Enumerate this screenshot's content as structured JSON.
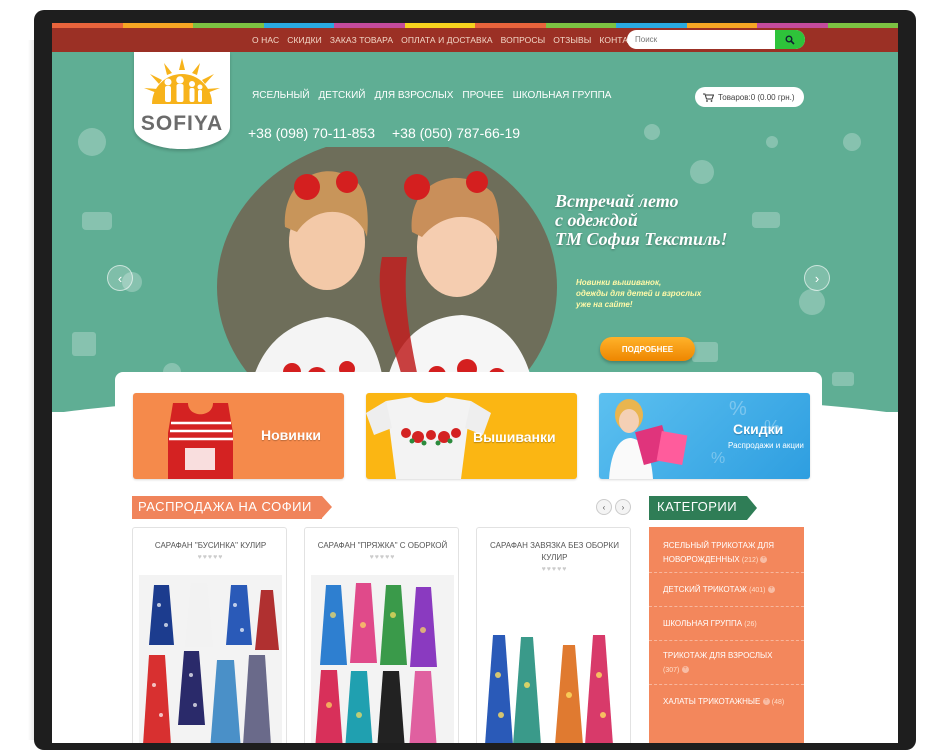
{
  "stripe_colors": [
    "#e8643c",
    "#f6a623",
    "#7cc142",
    "#2aa9e0",
    "#c44b9c",
    "#f6d21e",
    "#e8643c",
    "#7cc142",
    "#2aa9e0",
    "#f6a623",
    "#c44b9c",
    "#7cc142"
  ],
  "topnav": {
    "items": [
      "О НАС",
      "СКИДКИ",
      "ЗАКАЗ ТОВАРА",
      "ОПЛАТА И ДОСТАВКА",
      "ВОПРОСЫ",
      "ОТЗЫВЫ",
      "КОНТАКТЫ"
    ]
  },
  "search": {
    "placeholder": "Поиск",
    "icon": "search-icon"
  },
  "logo": {
    "text": "SOFIYA"
  },
  "mainnav": {
    "items": [
      "ЯСЕЛЬНЫЙ",
      "ДЕТСКИЙ",
      "ДЛЯ ВЗРОСЛЫХ",
      "ПРОЧЕЕ",
      "ШКОЛЬНАЯ ГРУППА"
    ]
  },
  "cart": {
    "label": "Товаров:0 (0.00 грн.)",
    "icon": "cart-icon"
  },
  "phones": [
    "+38 (098) 70-11-853",
    "+38 (050) 787-66-19"
  ],
  "hero": {
    "slogan": [
      "Встречай лето",
      "с одеждой",
      "ТМ София Текстиль!"
    ],
    "sub": [
      "Новинки вышиванок,",
      "одежды для детей и взрослых",
      "уже на сайте!"
    ],
    "button": "ПОДРОБНЕЕ",
    "prev": "‹",
    "next": "›"
  },
  "banners": [
    {
      "label": "Новинки",
      "color": "#f58a4b"
    },
    {
      "label": "Вышиванки",
      "color": "#fbb613"
    },
    {
      "label": "Скидки",
      "sub": "Распродажи и акции",
      "color": "#2e9ee0"
    }
  ],
  "sale": {
    "title": "РАСПРОДАЖА НА СОФИИ",
    "prev": "‹",
    "next": "›"
  },
  "products": [
    {
      "title": "САРАФАН \"БУСИНКА\" КУЛИР"
    },
    {
      "title": "САРАФАН \"ПРЯЖКА\" С ОБОРКОЙ"
    },
    {
      "title": "САРАФАН ЗАВЯЗКА БЕЗ ОБОРКИ КУЛИР"
    }
  ],
  "stars": "♥♥♥♥♥",
  "categories": {
    "title": "КАТЕГОРИИ",
    "items": [
      {
        "name": "ЯСЕЛЬНЫЙ ТРИКОТАЖ ДЛЯ НОВОРОЖДЕННЫХ",
        "count": "(212)"
      },
      {
        "name": "ДЕТСКИЙ ТРИКОТАЖ",
        "count": "(401)"
      },
      {
        "name": "ШКОЛЬНАЯ ГРУППА",
        "count": "(26)"
      },
      {
        "name": "ТРИКОТАЖ ДЛЯ ВЗРОСЛЫХ",
        "count": "(307)"
      },
      {
        "name": "ХАЛАТЫ ТРИКОТАЖНЫЕ",
        "count": "(48)"
      }
    ]
  }
}
